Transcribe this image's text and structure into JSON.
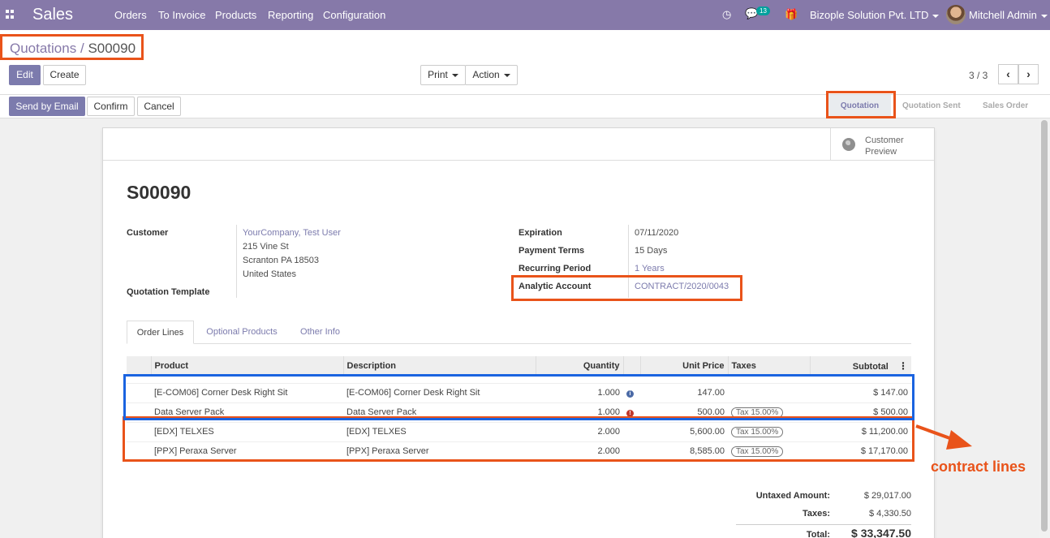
{
  "app_title": "Sales",
  "nav": [
    "Orders",
    "To Invoice",
    "Products",
    "Reporting",
    "Configuration"
  ],
  "messages_count": "13",
  "company": "Bizople Solution Pvt. LTD",
  "user": "Mitchell Admin",
  "breadcrumb": {
    "parent": "Quotations",
    "sep": "/",
    "current": "S00090"
  },
  "buttons": {
    "edit": "Edit",
    "create": "Create",
    "print": "Print",
    "action": "Action",
    "send_email": "Send by Email",
    "confirm": "Confirm",
    "cancel": "Cancel"
  },
  "pager": "3 / 3",
  "stages": [
    "Quotation",
    "Quotation Sent",
    "Sales Order"
  ],
  "active_stage": "Quotation",
  "customer_preview": {
    "line1": "Customer",
    "line2": "Preview"
  },
  "record_name": "S00090",
  "fields": {
    "customer_label": "Customer",
    "customer_name": "YourCompany, Test User",
    "address1": "215 Vine St",
    "address2": "Scranton PA 18503",
    "address3": "United States",
    "template_label": "Quotation Template",
    "expiration_label": "Expiration",
    "expiration": "07/11/2020",
    "payment_terms_label": "Payment Terms",
    "payment_terms": "15 Days",
    "recurring_label": "Recurring Period",
    "recurring": "1 Years",
    "analytic_label": "Analytic Account",
    "analytic": "CONTRACT/2020/0043"
  },
  "tabs": [
    "Order Lines",
    "Optional Products",
    "Other Info"
  ],
  "table": {
    "headers": [
      "Product",
      "Description",
      "Quantity",
      "Unit Price",
      "Taxes",
      "Subtotal"
    ],
    "rows": [
      {
        "product": "[E-COM06] Corner Desk Right Sit",
        "description": "[E-COM06] Corner Desk Right Sit",
        "qty": "1.000",
        "price": "147.00",
        "tax": "",
        "subtotal": "$ 147.00"
      },
      {
        "product": "Data Server Pack",
        "description": "Data Server Pack",
        "qty": "1.000",
        "price": "500.00",
        "tax": "Tax 15.00%",
        "subtotal": "$ 500.00"
      },
      {
        "product": "[EDX] TELXES",
        "description": "[EDX] TELXES",
        "qty": "2.000",
        "price": "5,600.00",
        "tax": "Tax 15.00%",
        "subtotal": "$ 11,200.00"
      },
      {
        "product": "[PPX] Peraxa Server",
        "description": "[PPX] Peraxa Server",
        "qty": "2.000",
        "price": "8,585.00",
        "tax": "Tax 15.00%",
        "subtotal": "$ 17,170.00"
      }
    ]
  },
  "totals": {
    "untaxed_label": "Untaxed Amount:",
    "untaxed": "$ 29,017.00",
    "taxes_label": "Taxes:",
    "taxes": "$ 4,330.50",
    "total_label": "Total:",
    "total": "$ 33,347.50"
  },
  "annotation_text": "contract lines",
  "colors": {
    "brand": "#8679a9",
    "primary": "#7c7bad",
    "annotation_orange": "#e9531a",
    "annotation_blue": "#1a63e0"
  }
}
